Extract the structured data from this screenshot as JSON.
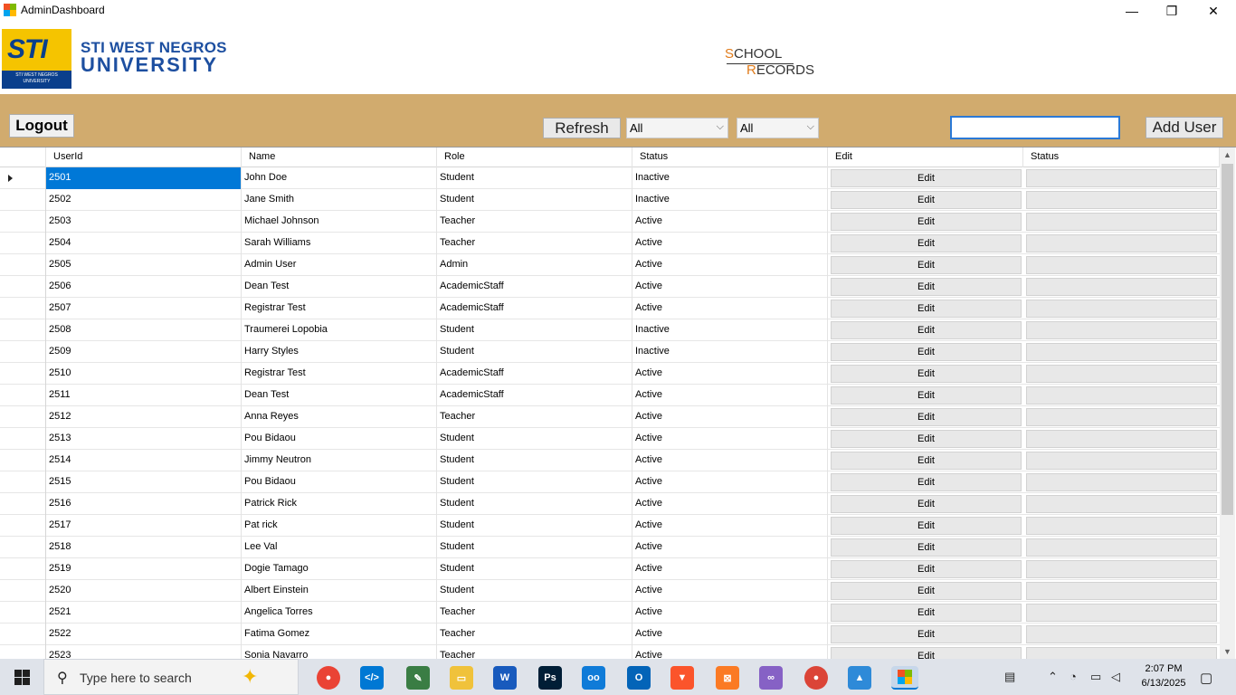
{
  "window": {
    "title": "AdminDashboard",
    "min": "—",
    "max": "❐",
    "close": "✕"
  },
  "brand": {
    "logo_text": "STI",
    "logo_sub": "STI WEST NEGROS UNIVERSITY",
    "line1": "STI WEST NEGROS",
    "line2": "UNIVERSITY",
    "school_s": "S",
    "school_rest": "CHOOL",
    "records_r": "R",
    "records_rest": "ECORDS"
  },
  "toolbar": {
    "logout": "Logout",
    "refresh": "Refresh",
    "filter1": "All",
    "filter2": "All",
    "search_value": "",
    "add_user": "Add User"
  },
  "grid": {
    "headers": [
      "UserId",
      "Name",
      "Role",
      "Status",
      "Edit",
      "Status"
    ],
    "edit_label": "Edit",
    "rows": [
      {
        "id": "2501",
        "name": "John Doe",
        "role": "Student",
        "status": "Inactive"
      },
      {
        "id": "2502",
        "name": "Jane Smith",
        "role": "Student",
        "status": "Inactive"
      },
      {
        "id": "2503",
        "name": "Michael Johnson",
        "role": "Teacher",
        "status": "Active"
      },
      {
        "id": "2504",
        "name": "Sarah Williams",
        "role": "Teacher",
        "status": "Active"
      },
      {
        "id": "2505",
        "name": "Admin User",
        "role": "Admin",
        "status": "Active"
      },
      {
        "id": "2506",
        "name": "Dean Test",
        "role": "AcademicStaff",
        "status": "Active"
      },
      {
        "id": "2507",
        "name": "Registrar Test",
        "role": "AcademicStaff",
        "status": "Active"
      },
      {
        "id": "2508",
        "name": "Traumerei Lopobia",
        "role": "Student",
        "status": "Inactive"
      },
      {
        "id": "2509",
        "name": "Harry Styles",
        "role": "Student",
        "status": "Inactive"
      },
      {
        "id": "2510",
        "name": "Registrar Test",
        "role": "AcademicStaff",
        "status": "Active"
      },
      {
        "id": "2511",
        "name": "Dean Test",
        "role": "AcademicStaff",
        "status": "Active"
      },
      {
        "id": "2512",
        "name": "Anna Reyes",
        "role": "Teacher",
        "status": "Active"
      },
      {
        "id": "2513",
        "name": "Pou Bidaou",
        "role": "Student",
        "status": "Active"
      },
      {
        "id": "2514",
        "name": "Jimmy Neutron",
        "role": "Student",
        "status": "Active"
      },
      {
        "id": "2515",
        "name": "Pou Bidaou",
        "role": "Student",
        "status": "Active"
      },
      {
        "id": "2516",
        "name": "Patrick Rick",
        "role": "Student",
        "status": "Active"
      },
      {
        "id": "2517",
        "name": "Pat rick",
        "role": "Student",
        "status": "Active"
      },
      {
        "id": "2518",
        "name": "Lee Val",
        "role": "Student",
        "status": "Active"
      },
      {
        "id": "2519",
        "name": "Dogie Tamago",
        "role": "Student",
        "status": "Active"
      },
      {
        "id": "2520",
        "name": "Albert Einstein",
        "role": "Student",
        "status": "Active"
      },
      {
        "id": "2521",
        "name": "Angelica Torres",
        "role": "Teacher",
        "status": "Active"
      },
      {
        "id": "2522",
        "name": "Fatima Gomez",
        "role": "Teacher",
        "status": "Active"
      },
      {
        "id": "2523",
        "name": "Sonia Navarro",
        "role": "Teacher",
        "status": "Active"
      }
    ]
  },
  "taskbar": {
    "search_placeholder": "Type here to search",
    "apps": [
      "chrome",
      "vscode",
      "git",
      "file-explorer",
      "word",
      "photoshop",
      "teams",
      "outlook",
      "brave",
      "xampp",
      "visual-studio",
      "chrome-profile",
      "photos",
      "winforms-app"
    ],
    "time": "2:07 PM",
    "date": "6/13/2025"
  }
}
